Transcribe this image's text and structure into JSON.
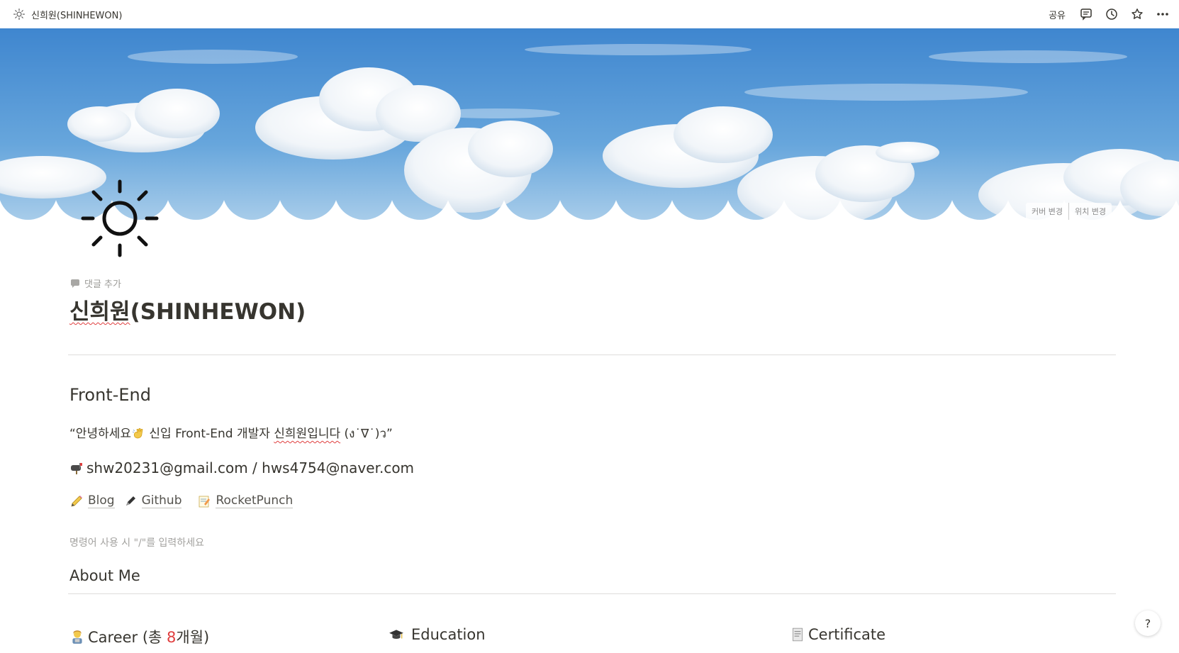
{
  "topbar": {
    "page_title": "신희원(SHINHEWON)",
    "share_label": "공유",
    "icons": [
      "comment-icon",
      "history-icon",
      "star-icon",
      "more-icon"
    ]
  },
  "cover": {
    "change_cover_label": "커버 변경",
    "reposition_label": "위치 변경"
  },
  "page": {
    "add_comment_label": "댓글 추가",
    "title_underlined": "신희원",
    "title_rest": "(SHINHEWON)",
    "section_frontend": "Front-End",
    "quote_open": "“안녕하세요",
    "quote_mid": " 신입 Front-End 개발자 ",
    "quote_underlined": "신희원입니다",
    "quote_end": " (ง˙∇˙)ว”",
    "emails": "shw20231@gmail.com / hws4754@naver.com",
    "links": [
      {
        "label": "Blog",
        "icon": "pencil-icon"
      },
      {
        "label": "Github",
        "icon": "pen-icon"
      },
      {
        "label": "RocketPunch",
        "icon": "memo-icon"
      }
    ],
    "placeholder": "명령어 사용 시 \"/\"를 입력하세요",
    "section_about": "About Me",
    "columns": {
      "career_prefix": "Career (총 ",
      "career_number": "8",
      "career_suffix": "개월)",
      "education": "Education",
      "certificate": "Certificate"
    }
  },
  "help_label": "?",
  "colors": {
    "text": "#37352f",
    "muted": "#9b9a97",
    "accent_red": "#e03e3e",
    "sky": "#4a90d6"
  }
}
